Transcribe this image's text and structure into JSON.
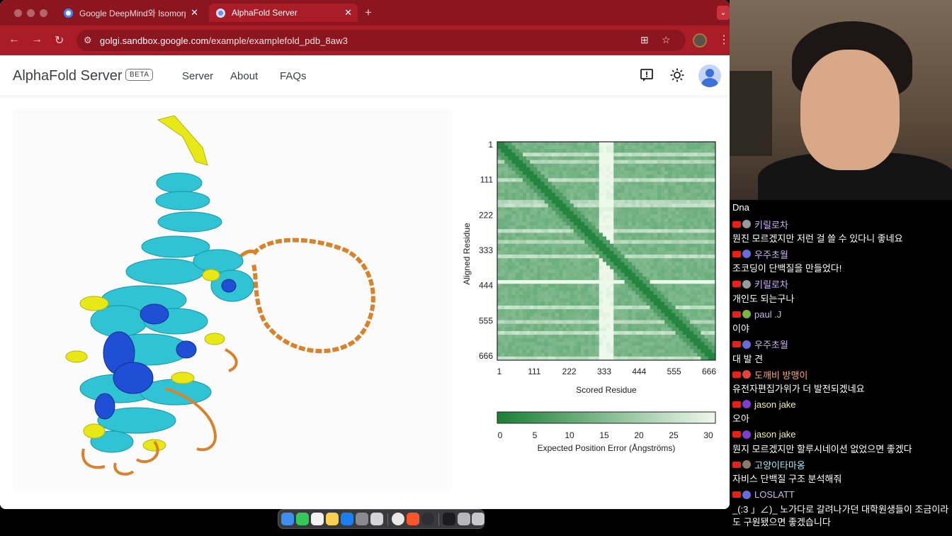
{
  "browser": {
    "tabs": [
      {
        "title": "Google DeepMind와 Isomorph",
        "active": false
      },
      {
        "title": "AlphaFold Server",
        "active": true
      }
    ],
    "new_tab_label": "+",
    "url_host": "golgi.sandbox.google.com",
    "url_path": "/example/examplefold_pdb_8aw3"
  },
  "app": {
    "brand": "AlphaFold Server",
    "badge": "BETA",
    "nav": [
      "Server",
      "About",
      "FAQs"
    ]
  },
  "pae": {
    "y_axis_label": "Aligned Residue",
    "x_axis_label": "Scored Residue",
    "ticks": [
      "1",
      "111",
      "222",
      "333",
      "444",
      "555",
      "666"
    ],
    "colorbar_ticks": [
      "0",
      "5",
      "10",
      "15",
      "20",
      "25",
      "30"
    ],
    "colorbar_label": "Expected Position Error (Ångströms)",
    "colors": {
      "low": "#1a7f37",
      "high": "#eef8ea"
    }
  },
  "chat": {
    "first_line": "Dna",
    "messages": [
      {
        "user": "키릴로차",
        "text": "뭔진 모르겠지만 저런 걸 쓸 수 있다니 좋네요",
        "name_color": "#c9b4f0",
        "avatar_color": "#9a9a9a"
      },
      {
        "user": "우주초월",
        "text": "조코딩이 단백질을 만들었다!",
        "name_color": "#c9b4f0",
        "avatar_color": "#6a6ad8"
      },
      {
        "user": "키릴로차",
        "text": "개인도 되는구나",
        "name_color": "#c9b4f0",
        "avatar_color": "#9a9a9a"
      },
      {
        "user": "paul .J",
        "text": "이야",
        "name_color": "#c9b4f0",
        "avatar_color": "#7cb342"
      },
      {
        "user": "우주초월",
        "text": "대 발 견",
        "name_color": "#c9b4f0",
        "avatar_color": "#6a6ad8"
      },
      {
        "user": "도깨비 방맹이",
        "text": "유전자편집가위가 더 발전되겠네요",
        "name_color": "#f4a58a",
        "avatar_color": "#e2453b"
      },
      {
        "user": "jason jake",
        "text": "오아",
        "name_color": "#f5f0a8",
        "avatar_color": "#7a3fd1"
      },
      {
        "user": "jason jake",
        "text": "뭔지 모르겠지만 할루시네이션 없었으면 좋겠다",
        "name_color": "#f5f0a8",
        "avatar_color": "#7a3fd1"
      },
      {
        "user": "고양이타마옹",
        "text": "자비스 단백질 구조 분석해줘",
        "name_color": "#a8e6f5",
        "avatar_color": "#8a7a6a"
      },
      {
        "user": "LOSLATT",
        "text": "_(:3 」∠)_ 노가다로 갈려나가던 대학원생들이 조금이라",
        "text2": "도 구원됐으면 좋겠습니다",
        "name_color": "#c9b4f0",
        "avatar_color": "#6a6ad8"
      }
    ]
  }
}
